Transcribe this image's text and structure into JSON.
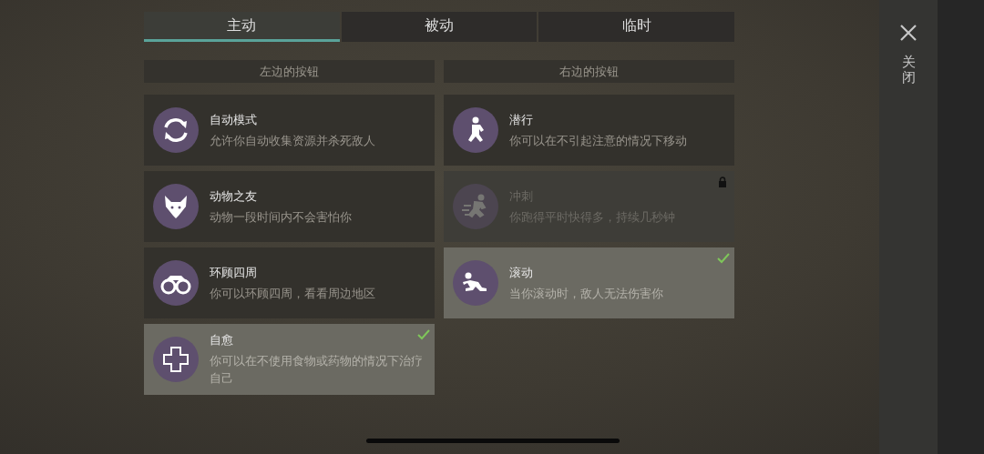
{
  "tabs": [
    {
      "label": "主动",
      "selected": true
    },
    {
      "label": "被动",
      "selected": false
    },
    {
      "label": "临时",
      "selected": false
    }
  ],
  "columns": [
    {
      "header": "左边的按钮",
      "skills": [
        {
          "kind": "cycle",
          "title": "自动模式",
          "description": "允许你自动收集资源并杀死敌人",
          "checked": false,
          "locked": false
        },
        {
          "kind": "fox",
          "title": "动物之友",
          "description": "动物一段时间内不会害怕你",
          "checked": false,
          "locked": false
        },
        {
          "kind": "binoculars",
          "title": "环顾四周",
          "description": "你可以环顾四周，看看周边地区",
          "checked": false,
          "locked": false
        },
        {
          "kind": "cross",
          "title": "自愈",
          "description": "你可以在不使用食物或药物的情况下治疗自己",
          "checked": true,
          "locked": false
        }
      ]
    },
    {
      "header": "右边的按钮",
      "skills": [
        {
          "kind": "crouch",
          "title": "潜行",
          "description": "你可以在不引起注意的情况下移动",
          "checked": false,
          "locked": false
        },
        {
          "kind": "sprint",
          "title": "冲刺",
          "description": "你跑得平时快得多，持续几秒钟",
          "checked": false,
          "locked": true
        },
        {
          "kind": "roll",
          "title": "滚动",
          "description": "当你滚动时，敌人无法伤害你",
          "checked": true,
          "locked": false
        }
      ]
    }
  ],
  "close": {
    "label": "关闭"
  }
}
